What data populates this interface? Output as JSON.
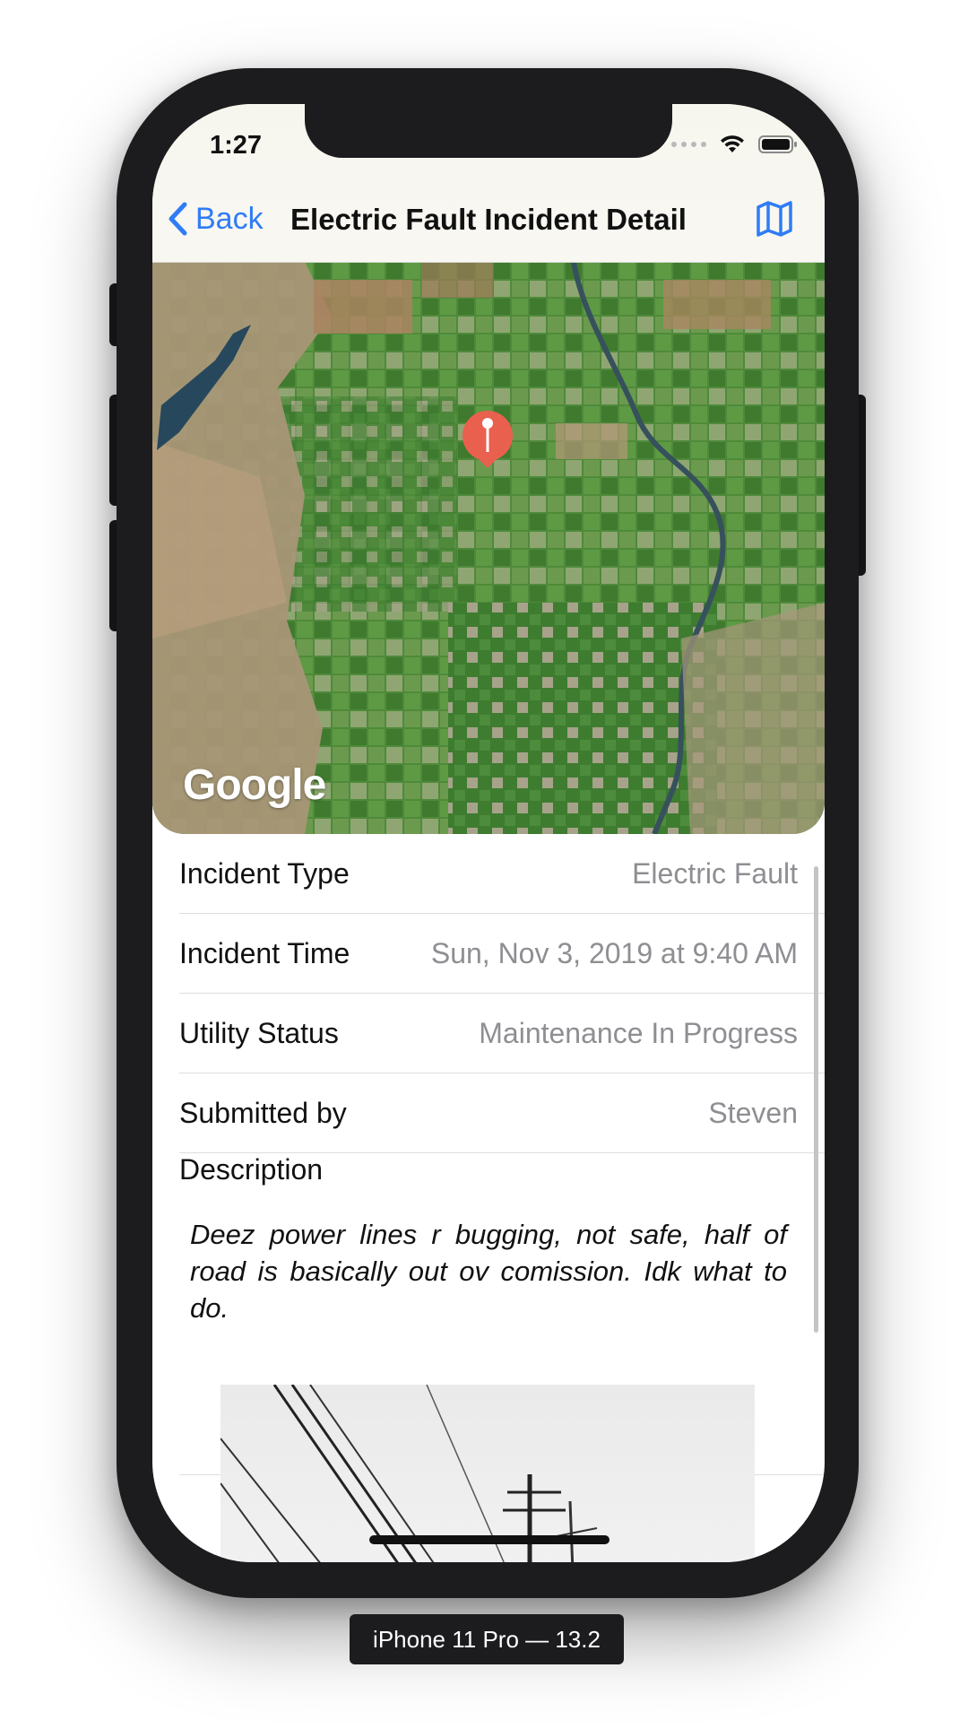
{
  "status_bar": {
    "time": "1:27"
  },
  "nav": {
    "back_label": "Back",
    "title": "Electric Fault Incident Detail",
    "right_icon": "map-icon",
    "accent": "#2f7cf6"
  },
  "map": {
    "attribution": "Google",
    "pin_color": "#e9604f"
  },
  "details": [
    {
      "label": "Incident Type",
      "value": "Electric Fault"
    },
    {
      "label": "Incident Time",
      "value": "Sun, Nov 3, 2019 at 9:40 AM"
    },
    {
      "label": "Utility Status",
      "value": "Maintenance In Progress"
    },
    {
      "label": "Submitted by",
      "value": "Steven"
    }
  ],
  "description": {
    "label": "Description",
    "text": "Deez power lines r bugging, not safe, half of road is basically out ov comission. Idk what to do."
  },
  "simulator_label": "iPhone 11 Pro — 13.2"
}
